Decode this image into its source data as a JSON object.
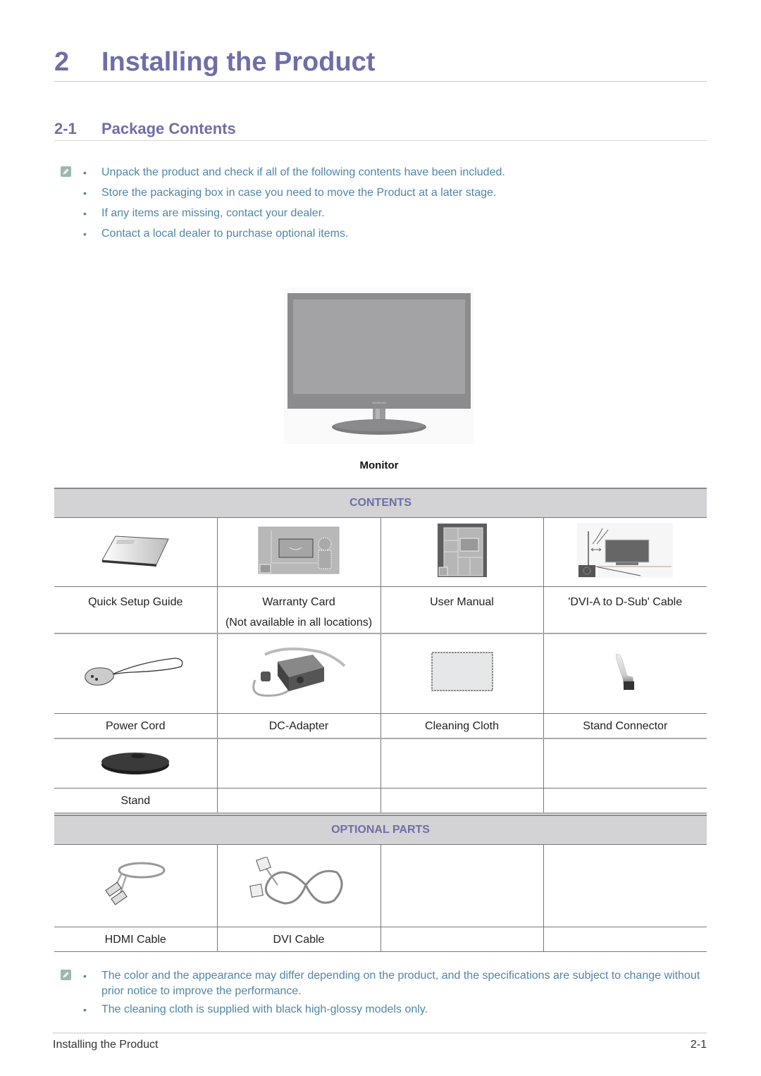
{
  "chapter": {
    "number": "2",
    "title": "Installing the Product"
  },
  "section": {
    "number": "2-1",
    "title": "Package Contents"
  },
  "intro_notes": {
    "icon": "note-pencil-icon",
    "items": [
      "Unpack the product and check if all of the following contents have been included.",
      "Store the packaging box in case you need to move the Product at a later stage.",
      "If any items are missing, contact your dealer.",
      "Contact a local dealer to purchase optional items."
    ]
  },
  "monitor": {
    "caption": "Monitor",
    "brand_text": "SAMSUNG"
  },
  "contents_table": {
    "header": "CONTENTS",
    "rows": [
      [
        {
          "label": "Quick Setup Guide",
          "sub": "",
          "icon": "quick-setup-guide-image"
        },
        {
          "label": "Warranty Card",
          "sub": "(Not available in all locations)",
          "icon": "warranty-card-image"
        },
        {
          "label": "User Manual",
          "sub": "",
          "icon": "user-manual-image"
        },
        {
          "label": "'DVI-A to D-Sub' Cable",
          "sub": "",
          "icon": "dvi-a-to-dsub-cable-image"
        }
      ],
      [
        {
          "label": "Power Cord",
          "icon": "power-cord-image"
        },
        {
          "label": "DC-Adapter",
          "icon": "dc-adapter-image"
        },
        {
          "label": "Cleaning Cloth",
          "icon": "cleaning-cloth-image"
        },
        {
          "label": "Stand Connector",
          "icon": "stand-connector-image"
        }
      ],
      [
        {
          "label": "Stand",
          "icon": "stand-image"
        },
        {
          "label": ""
        },
        {
          "label": ""
        },
        {
          "label": ""
        }
      ]
    ]
  },
  "optional_table": {
    "header": "OPTIONAL PARTS",
    "rows": [
      [
        {
          "label": "HDMI Cable",
          "icon": "hdmi-cable-image"
        },
        {
          "label": "DVI Cable",
          "icon": "dvi-cable-image"
        },
        {
          "label": ""
        },
        {
          "label": ""
        }
      ]
    ]
  },
  "bottom_notes": {
    "icon": "note-pencil-icon",
    "items": [
      "The color and the appearance may differ depending on the product, and the specifications are subject to change without prior notice to improve the performance.",
      "The cleaning cloth is supplied with black high-glossy models only."
    ]
  },
  "footer": {
    "left": "Installing the Product",
    "right": "2-1"
  },
  "colors": {
    "heading": "#6e6ea8",
    "note_text": "#4f86a8",
    "table_header_bg": "#d3d3d5"
  }
}
